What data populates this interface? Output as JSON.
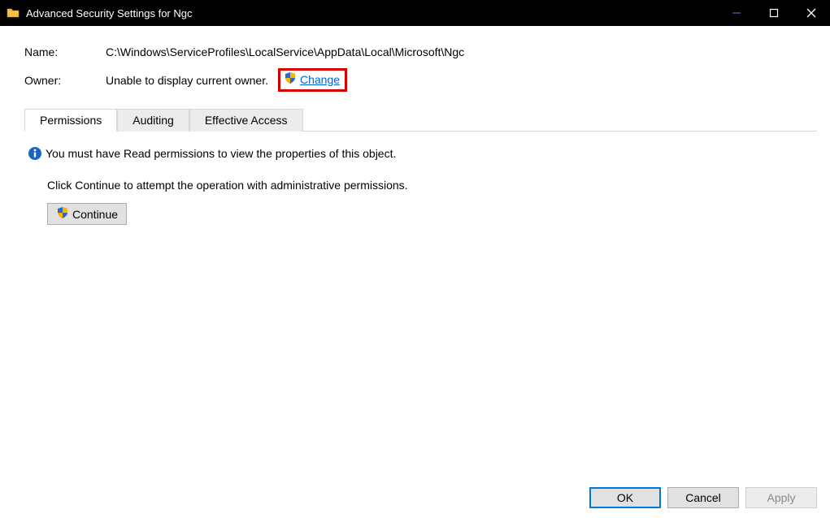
{
  "titlebar": {
    "title": "Advanced Security Settings for Ngc"
  },
  "fields": {
    "name_label": "Name:",
    "name_value": "C:\\Windows\\ServiceProfiles\\LocalService\\AppData\\Local\\Microsoft\\Ngc",
    "owner_label": "Owner:",
    "owner_value": "Unable to display current owner.",
    "change_link": "Change"
  },
  "tabs": {
    "permissions": "Permissions",
    "auditing": "Auditing",
    "effective": "Effective Access"
  },
  "body": {
    "info_message": "You must have Read permissions to view the properties of this object.",
    "continue_hint": "Click Continue to attempt the operation with administrative permissions.",
    "continue_button": "Continue"
  },
  "buttons": {
    "ok": "OK",
    "cancel": "Cancel",
    "apply": "Apply"
  }
}
